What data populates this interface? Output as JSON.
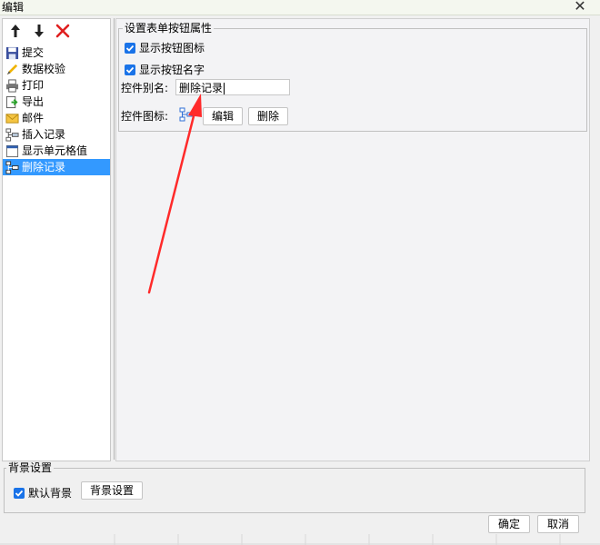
{
  "window": {
    "title": "编辑"
  },
  "toolbar": {
    "up_icon": "arrow-up-icon",
    "down_icon": "arrow-down-icon",
    "delete_icon": "delete-x-icon"
  },
  "list": {
    "items": [
      {
        "label": "提交",
        "icon": "save-icon"
      },
      {
        "label": "数据校验",
        "icon": "pencil-icon"
      },
      {
        "label": "打印",
        "icon": "printer-icon"
      },
      {
        "label": "导出",
        "icon": "export-icon"
      },
      {
        "label": "邮件",
        "icon": "mail-icon"
      },
      {
        "label": "插入记录",
        "icon": "insert-record-icon"
      },
      {
        "label": "显示单元格值",
        "icon": "cell-icon"
      },
      {
        "label": "删除记录",
        "icon": "delete-record-icon",
        "selected": true
      }
    ]
  },
  "props": {
    "group_title": "设置表单按钮属性",
    "show_icon_label": "显示按钮图标",
    "show_name_label": "显示按钮名字",
    "alias_label": "控件别名:",
    "alias_value": "删除记录",
    "icon_label": "控件图标:",
    "edit_button": "编辑",
    "delete_button": "删除"
  },
  "background": {
    "group_title": "背景设置",
    "default_label": "默认背景",
    "settings_button": "背景设置"
  },
  "footer": {
    "ok_button": "确定",
    "cancel_button": "取消"
  },
  "colors": {
    "selection": "#3399ff",
    "checkbox": "#1a73e8",
    "annotation_arrow": "#ff2a2a"
  }
}
